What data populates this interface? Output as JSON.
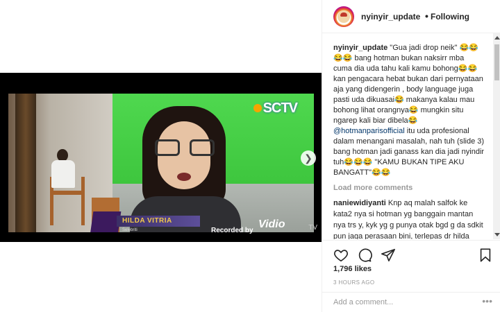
{
  "video": {
    "channel_logo": "SCTV",
    "lower_third_name": "HILDA VITRIA",
    "lower_third_sub": "Selebriti",
    "recorded_label": "Recorded by",
    "watermark": "Vidio",
    "tv_tag": "TV",
    "next_icon": "chevron-right-icon"
  },
  "header": {
    "username": "nyinyir_update",
    "separator": "•",
    "follow_status": "Following"
  },
  "caption": {
    "username": "nyinyir_update",
    "text_part1": " \"Gua jadi drop neik\" 😂😂😂😂 bang hotman bukan naksirr mba cuma dia uda tahu kali kamu bohong😂😂 kan pengacara hebat bukan dari pernyataan aja yang didengerin , body language juga pasti uda dikuasai😂 makanya kalau mau bohong lihat orangnya😂 mungkin situ ngarep kali biar dibela😂 ",
    "mention": "@hotmanparisofficial",
    "text_part2": " itu uda profesional dalam menangani masalah, nah tuh (slide 3) bang hotman jadi ganass kan dia jadi nyindir tuh😂😂😂 \"KAMU BUKAN TIPE AKU BANGATT\"😂😂"
  },
  "load_more": "Load more comments",
  "comments": [
    {
      "username": "naniewidiyanti",
      "text": " Knp aq malah salfok ke kata2 nya si hotman yg banggain mantan nya trs y, kyk yg g punya otak bgd g da sdkit pun jaga perasaan bini, terlepas dr hilda tukang bohong, tp g"
    }
  ],
  "actions": {
    "like_icon": "heart-icon",
    "comment_icon": "comment-icon",
    "share_icon": "share-icon",
    "save_icon": "bookmark-icon"
  },
  "likes": "1,796 likes",
  "time": "3 HOURS AGO",
  "add_comment": {
    "placeholder": "Add a comment...",
    "more": "•••"
  },
  "colors": {
    "mention": "#003569",
    "muted": "#999999",
    "text": "#262626",
    "border": "#efefef"
  }
}
